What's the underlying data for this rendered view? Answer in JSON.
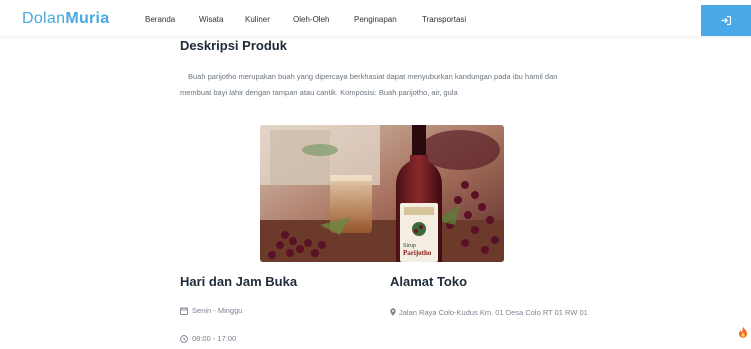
{
  "brand": {
    "part1": "Dolan",
    "part2": "Muria"
  },
  "nav": {
    "items": [
      {
        "label": "Beranda"
      },
      {
        "label": "Wisata"
      },
      {
        "label": "Kuliner"
      },
      {
        "label": "Oleh-Oleh"
      },
      {
        "label": "Penginapan"
      },
      {
        "label": "Transportasi"
      }
    ]
  },
  "login": {
    "icon": "sign-in-icon"
  },
  "product": {
    "description_title": "Deskripsi Produk",
    "description": "Buah parijotho merupakan buah yang dipercaya berkhasiat dapat menyuburkan kandungan pada ibu hamil dan membuat bayi lahir dengan tampan atau cantik. Komposisi: Buah parijotho, air, gula",
    "image_label_line1": "Sirup",
    "image_label_line2": "Parijotho"
  },
  "hours": {
    "title": "Hari dan Jam Buka",
    "days": "Senin - Minggu",
    "time": "08:00 - 17:00"
  },
  "store": {
    "title": "Alamat Toko",
    "address": "Jalan Raya Colo-Kudus Km. 01 Desa Colo RT 01 RW 01"
  },
  "colors": {
    "accent": "#4aa8e8",
    "heading": "#1e2b38",
    "fire": "#f26b2b"
  }
}
